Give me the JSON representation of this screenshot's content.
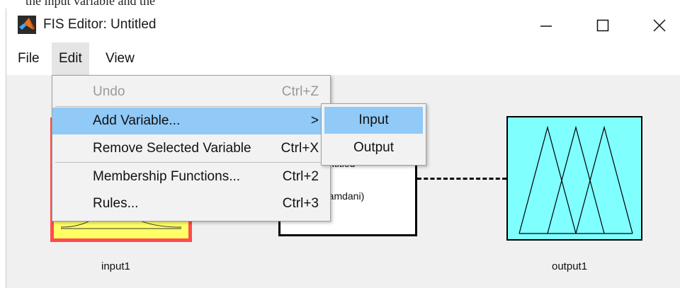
{
  "background_snippet": "the input variable and the",
  "window": {
    "title": "FIS Editor: Untitled",
    "controls": {
      "minimize": "—",
      "maximize": "☐",
      "close": "✕"
    }
  },
  "menubar": {
    "file": "File",
    "edit": "Edit",
    "view": "View"
  },
  "edit_menu": {
    "undo": {
      "label": "Undo",
      "shortcut": "Ctrl+Z"
    },
    "add_variable": {
      "label": "Add Variable...",
      "arrow": ">"
    },
    "remove_variable": {
      "label": "Remove Selected Variable",
      "shortcut": "Ctrl+X"
    },
    "membership_functions": {
      "label": "Membership Functions...",
      "shortcut": "Ctrl+2"
    },
    "rules": {
      "label": "Rules...",
      "shortcut": "Ctrl+3"
    }
  },
  "add_variable_submenu": {
    "input": "Input",
    "output": "Output"
  },
  "diagram": {
    "input_label": "input1",
    "output_label": "output1",
    "system_name_partial": "Untitled",
    "system_type_partial": "mamdani)"
  },
  "colors": {
    "input_fill": "#ffff66",
    "input_border": "#ff4c4c",
    "output_fill": "#80ffff",
    "menu_highlight": "#91c9f7"
  }
}
